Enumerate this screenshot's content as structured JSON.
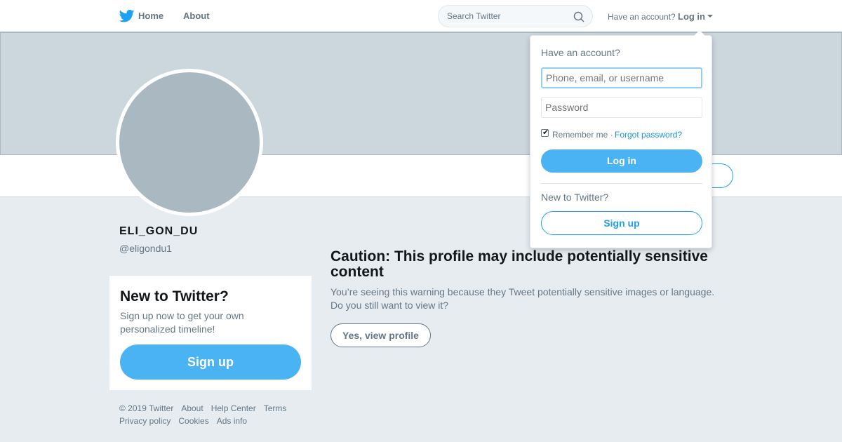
{
  "nav": {
    "home_label": "Home",
    "about_label": "About",
    "search_placeholder": "Search Twitter",
    "have_account_text": "Have an account?",
    "login_label": "Log in"
  },
  "profile": {
    "display_name": "ELI_GON_DU",
    "handle": "@eligondu1"
  },
  "signup_card": {
    "title": "New to Twitter?",
    "subtitle": "Sign up now to get your own personalized timeline!",
    "button_label": "Sign up"
  },
  "footer": {
    "links": [
      "© 2019 Twitter",
      "About",
      "Help Center",
      "Terms",
      "Privacy policy",
      "Cookies",
      "Ads info"
    ]
  },
  "caution": {
    "title": "Caution: This profile may include potentially sensitive content",
    "text": "You’re seeing this warning because they Tweet potentially sensitive images or language. Do you still want to view it?",
    "button_label": "Yes, view profile"
  },
  "login_dropdown": {
    "title": "Have an account?",
    "username_placeholder": "Phone, email, or username",
    "password_placeholder": "Password",
    "remember_checked": true,
    "remember_label": "Remember me ·",
    "forgot_label": "Forgot password?",
    "login_button": "Log in",
    "new_text": "New to Twitter?",
    "signup_button": "Sign up"
  },
  "colors": {
    "brand": "#1da1f2",
    "button_fill": "#4ab3f4",
    "background": "#e6ecf0",
    "banner": "#ccd6dd"
  }
}
